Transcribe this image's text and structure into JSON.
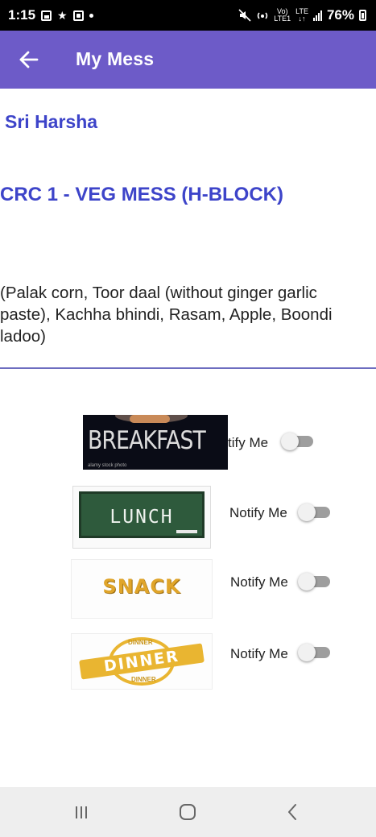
{
  "status_bar": {
    "time": "1:15",
    "volte_top": "Vo)",
    "volte_bottom": "LTE1",
    "network_top": "LTE",
    "network_bottom": "↓↑",
    "battery": "76%",
    "icons": [
      "gallery-icon",
      "usb-icon",
      "notification-icon",
      "dot-icon",
      "mute-icon",
      "hotspot-icon",
      "signal-icon",
      "battery-icon"
    ]
  },
  "app_bar": {
    "title": "My Mess",
    "back_icon": "arrow-left-icon",
    "color": "#6d5bc8"
  },
  "user": {
    "name": "Sri Harsha"
  },
  "mess": {
    "name": "CRC 1 - VEG MESS (H-BLOCK)",
    "menu": "(Palak corn, Toor daal (without ginger garlic paste), Kachha bhindi, Rasam, Apple, Boondi ladoo)"
  },
  "meals": [
    {
      "image_text": "BREAKFAST",
      "image_note": "alamy stock photo",
      "notify_label": "Notify Me",
      "visible_label": "tify Me",
      "notify_on": false
    },
    {
      "image_text": "LUNCH",
      "notify_label": "Notify Me",
      "notify_on": false
    },
    {
      "image_text": "SNACK",
      "notify_label": "Notify Me",
      "notify_on": false
    },
    {
      "image_text": "DINNER",
      "image_small": "DINNER",
      "notify_label": "Notify Me",
      "notify_on": false
    }
  ],
  "nav_bar": {
    "buttons": [
      "recent-apps-icon",
      "home-icon",
      "back-icon"
    ]
  },
  "colors": {
    "accent": "#6d5bc8",
    "heading": "#3d44c9",
    "toggle_off_track": "#9e9e9e",
    "toggle_off_thumb": "#f1f1f1"
  }
}
